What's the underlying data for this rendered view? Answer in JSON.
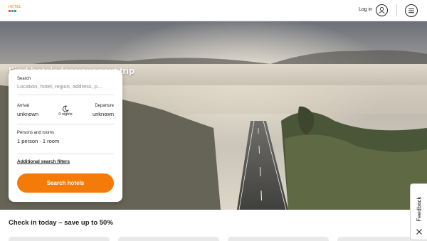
{
  "header": {
    "logo_text": "HOTEL",
    "login_label": "Log in",
    "icons": [
      "user-icon",
      "menu-icon"
    ],
    "brand_colors": [
      "#f7a51c",
      "#e84b3c",
      "#2d9cdb",
      "#27ae60"
    ]
  },
  "hero": {
    "title": "Find hotels for your next trip"
  },
  "search_card": {
    "search_label": "Search",
    "search_placeholder": "Location, hotel, region, address, p...",
    "arrival_label": "Arrival",
    "arrival_value": "unknown",
    "nights_value": "0 nights",
    "departure_label": "Departure",
    "departure_value": "unknown",
    "persons_label": "Persons and rooms",
    "persons_value": "1 person · 1 room",
    "filters_link": "Additional search filters",
    "search_button": "Search hotels",
    "button_color": "#f47b0a"
  },
  "deals": {
    "title": "Check in today – save up to 50%"
  },
  "feedback": {
    "label": "Feedback"
  }
}
